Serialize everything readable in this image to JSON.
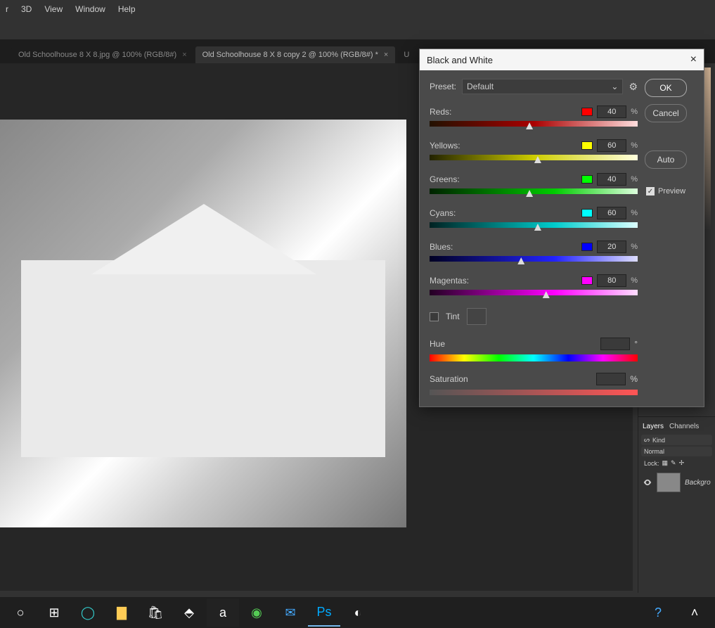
{
  "menu": {
    "items": [
      "r",
      "3D",
      "View",
      "Window",
      "Help"
    ]
  },
  "tabs": [
    {
      "label": "Old Schoolhouse 8 X 8.jpg @ 100% (RGB/8#)",
      "active": false
    },
    {
      "label": "Old Schoolhouse 8 X 8 copy 2 @ 100% (RGB/8#) *",
      "active": true
    },
    {
      "label": "U",
      "active": false
    }
  ],
  "dialog": {
    "title": "Black and White",
    "preset_label": "Preset:",
    "preset_value": "Default",
    "ok": "OK",
    "cancel": "Cancel",
    "auto": "Auto",
    "preview": "Preview",
    "tint_label": "Tint",
    "hue_label": "Hue",
    "hue_unit": "°",
    "sat_label": "Saturation",
    "sat_unit": "%",
    "sliders": [
      {
        "label": "Reds:",
        "value": "40",
        "color": "#ff0000",
        "grad": "grad-red",
        "pos": 48
      },
      {
        "label": "Yellows:",
        "value": "60",
        "color": "#ffff00",
        "grad": "grad-yellow",
        "pos": 52
      },
      {
        "label": "Greens:",
        "value": "40",
        "color": "#00ff00",
        "grad": "grad-green",
        "pos": 48
      },
      {
        "label": "Cyans:",
        "value": "60",
        "color": "#00ffff",
        "grad": "grad-cyan",
        "pos": 52
      },
      {
        "label": "Blues:",
        "value": "20",
        "color": "#0000ff",
        "grad": "grad-blue",
        "pos": 44
      },
      {
        "label": "Magentas:",
        "value": "80",
        "color": "#ff00ff",
        "grad": "grad-magenta",
        "pos": 56
      }
    ],
    "pct": "%"
  },
  "layers": {
    "tab_layers": "Layers",
    "tab_channels": "Channels",
    "kind_label": "Kind",
    "blend_mode": "Normal",
    "lock_label": "Lock:",
    "bg_name": "Backgro"
  }
}
